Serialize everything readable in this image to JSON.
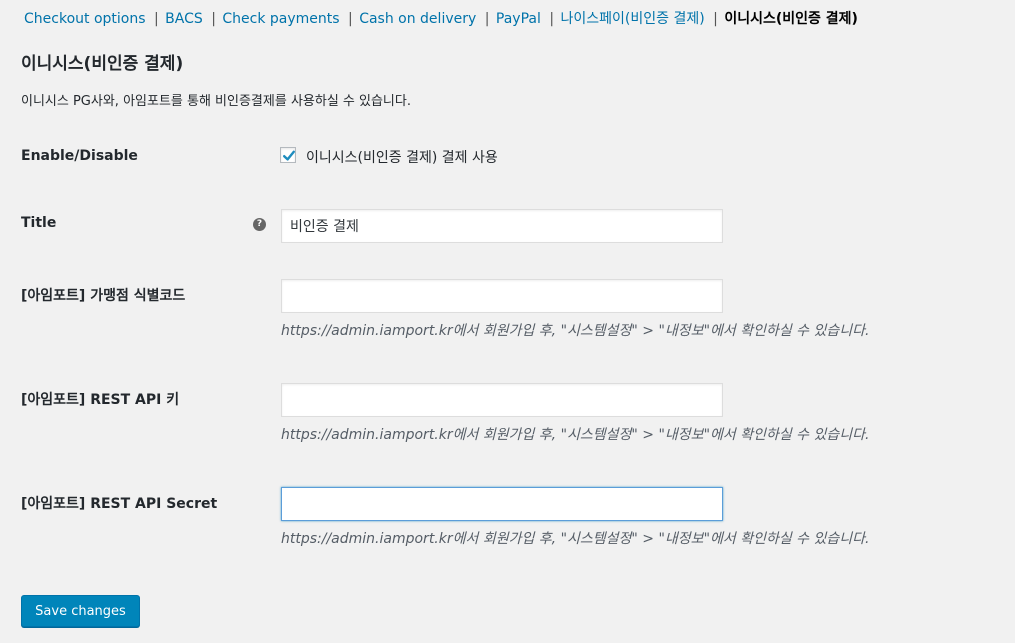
{
  "subnav": {
    "items": [
      {
        "label": "Checkout options"
      },
      {
        "label": "BACS"
      },
      {
        "label": "Check payments"
      },
      {
        "label": "Cash on delivery"
      },
      {
        "label": "PayPal"
      },
      {
        "label": "나이스페이(비인증 결제)"
      },
      {
        "label": "이니시스(비인증 결제)"
      }
    ],
    "separator": "|",
    "current_index": 6
  },
  "section": {
    "title": "이니시스(비인증 결제)",
    "description": "이니시스 PG사와, 아임포트를 통해 비인증결제를 사용하실 수 있습니다."
  },
  "fields": {
    "enable": {
      "label": "Enable/Disable",
      "checkbox_label": "이니시스(비인증 결제) 결제 사용",
      "checked": true
    },
    "title": {
      "label": "Title",
      "help_icon": "question-circle-icon",
      "help_glyph": "?",
      "value": "비인증 결제"
    },
    "merchant_code": {
      "label": "[아임포트] 가맹점 식별코드",
      "value": "",
      "description": "https://admin.iamport.kr에서 회원가입 후, \"시스템설정\" > \"내정보\"에서 확인하실 수 있습니다."
    },
    "rest_api_key": {
      "label": "[아임포트] REST API 키",
      "value": "",
      "description": "https://admin.iamport.kr에서 회원가입 후, \"시스템설정\" > \"내정보\"에서 확인하실 수 있습니다."
    },
    "rest_api_secret": {
      "label": "[아임포트] REST API Secret",
      "value": "",
      "focused": true,
      "description": "https://admin.iamport.kr에서 회원가입 후, \"시스템설정\" > \"내정보\"에서 확인하실 수 있습니다."
    }
  },
  "save_button": {
    "label": "Save changes"
  },
  "colors": {
    "link": "#0073aa",
    "primary_button": "#0085ba",
    "background": "#f1f1f1",
    "focus_border": "#5b9dd9",
    "checkmark": "#1e8cbe"
  }
}
